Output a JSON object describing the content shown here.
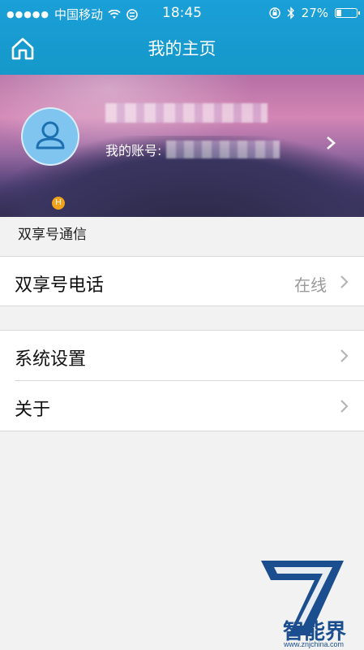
{
  "status_bar": {
    "carrier": "中国移动",
    "time": "18:45",
    "battery": "27%",
    "battery_level": 0.27
  },
  "nav": {
    "title": "我的主页",
    "home_icon": "home-icon"
  },
  "profile": {
    "account_label": "我的账号:",
    "badge": "H",
    "avatar_icon": "user-icon"
  },
  "sections": {
    "comm_label": "双享号通信",
    "phone": {
      "label": "双享号电话",
      "status": "在线"
    },
    "settings": {
      "label": "系统设置"
    },
    "about": {
      "label": "关于"
    }
  },
  "watermark": {
    "brand": "智能界",
    "url": "www.znjchina.com"
  }
}
